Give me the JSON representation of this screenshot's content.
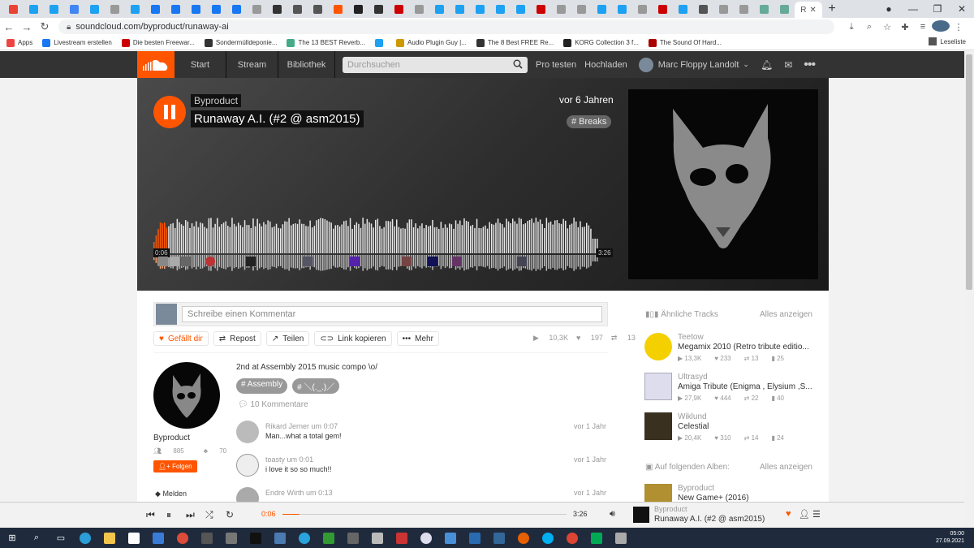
{
  "browser": {
    "tab_favicons": [
      "#ea4335",
      "#1da1f2",
      "#1da1f2",
      "#4285f4",
      "#1da1f2",
      "#999",
      "#1da1f2",
      "#1877f2",
      "#1877f2",
      "#1877f2",
      "#1877f2",
      "#1877f2",
      "#999",
      "#333",
      "#555",
      "#555",
      "#f50",
      "#222",
      "#333",
      "#c00",
      "#999",
      "#1da1f2",
      "#1da1f2",
      "#1da1f2",
      "#1da1f2",
      "#1da1f2",
      "#c00",
      "#999",
      "#999",
      "#1da1f2",
      "#1da1f2",
      "#999",
      "#c00",
      "#1da1f2",
      "#555",
      "#999",
      "#999",
      "#6a9",
      "#6a9"
    ],
    "active_tab_label": "R",
    "active_tab_close": "✕",
    "new_tab": "+",
    "url": "soundcloud.com/byproduct/runaway-ai",
    "bookmarks": [
      {
        "label": "Apps",
        "color": "#e44"
      },
      {
        "label": "Livestream erstellen",
        "color": "#1877f2"
      },
      {
        "label": "Die besten Freewar...",
        "color": "#c00"
      },
      {
        "label": "Sondermülldeponie...",
        "color": "#333"
      },
      {
        "label": "The 13 BEST Reverb...",
        "color": "#4a8"
      },
      {
        "label": "",
        "color": "#1da1f2"
      },
      {
        "label": "Audio Plugin Guy |...",
        "color": "#c90"
      },
      {
        "label": "The 8 Best FREE Re...",
        "color": "#333"
      },
      {
        "label": "KORG Collection 3 f...",
        "color": "#222"
      },
      {
        "label": "The Sound Of Hard...",
        "color": "#a00"
      }
    ],
    "reading_list": "Leseliste"
  },
  "header": {
    "nav": [
      "Start",
      "Stream",
      "Bibliothek"
    ],
    "search_placeholder": "Durchsuchen",
    "pro": "Pro testen",
    "upload": "Hochladen",
    "user": "Marc Floppy Landolt"
  },
  "hero": {
    "artist": "Byproduct",
    "title": "Runaway A.I. (#2 @ asm2015)",
    "ago": "vor 6 Jahren",
    "genre": "# Breaks",
    "time_current": "0:06",
    "time_total": "3:26",
    "progress": 0.03
  },
  "main": {
    "comment_placeholder": "Schreibe einen Kommentar",
    "actions": {
      "like": "Gefällt dir",
      "repost": "Repost",
      "share": "Teilen",
      "copy": "Link kopieren",
      "more": "Mehr"
    },
    "stats": {
      "plays": "10,3K",
      "likes": "197",
      "reposts": "13"
    },
    "artist_name": "Byproduct",
    "followers": "885",
    "tracks": "70",
    "follow": "Folgen",
    "report": "Melden",
    "description": "2nd at Assembly 2015 music compo \\o/",
    "tags": [
      "# Assembly",
      "# ＼(._.)／"
    ],
    "comment_count": "10 Kommentare",
    "comments": [
      {
        "user": "Rikard Jerner",
        "at": "um",
        "time": "0:07",
        "text": "Man...what a total gem!",
        "when": "vor 1 Jahr"
      },
      {
        "user": "toasty",
        "at": "um",
        "time": "0:01",
        "text": "i love it so so much!!",
        "when": "vor 1 Jahr"
      },
      {
        "user": "Endre Wirth",
        "at": "um",
        "time": "0:13",
        "text": "",
        "when": "vor 1 Jahr"
      }
    ]
  },
  "sidebar": {
    "related_header": "Ähnliche Tracks",
    "show_all": "Alles anzeigen",
    "related": [
      {
        "artist": "Teetow",
        "title": "Megamix 2010 (Retro tribute editio...",
        "plays": "13,3K",
        "likes": "233",
        "reposts": "13",
        "comments": "25"
      },
      {
        "artist": "Ultrasyd",
        "title": "Amiga Tribute (Enigma , Elysium ,S...",
        "plays": "27,9K",
        "likes": "444",
        "reposts": "22",
        "comments": "40"
      },
      {
        "artist": "Wiklund",
        "title": "Celestial",
        "plays": "20,4K",
        "likes": "310",
        "reposts": "14",
        "comments": "24"
      }
    ],
    "albums_header": "Auf folgenden Alben:",
    "albums_show_all": "Alles anzeigen",
    "album_artist": "Byproduct",
    "album_title": "New Game+ (2016)"
  },
  "player": {
    "current": "0:06",
    "total": "3:26",
    "progress": 0.06,
    "artist": "Byproduct",
    "title": "Runaway A.I. (#2 @ asm2015)"
  },
  "taskbar": {
    "time": "05:00",
    "date": "27.09.2021"
  }
}
